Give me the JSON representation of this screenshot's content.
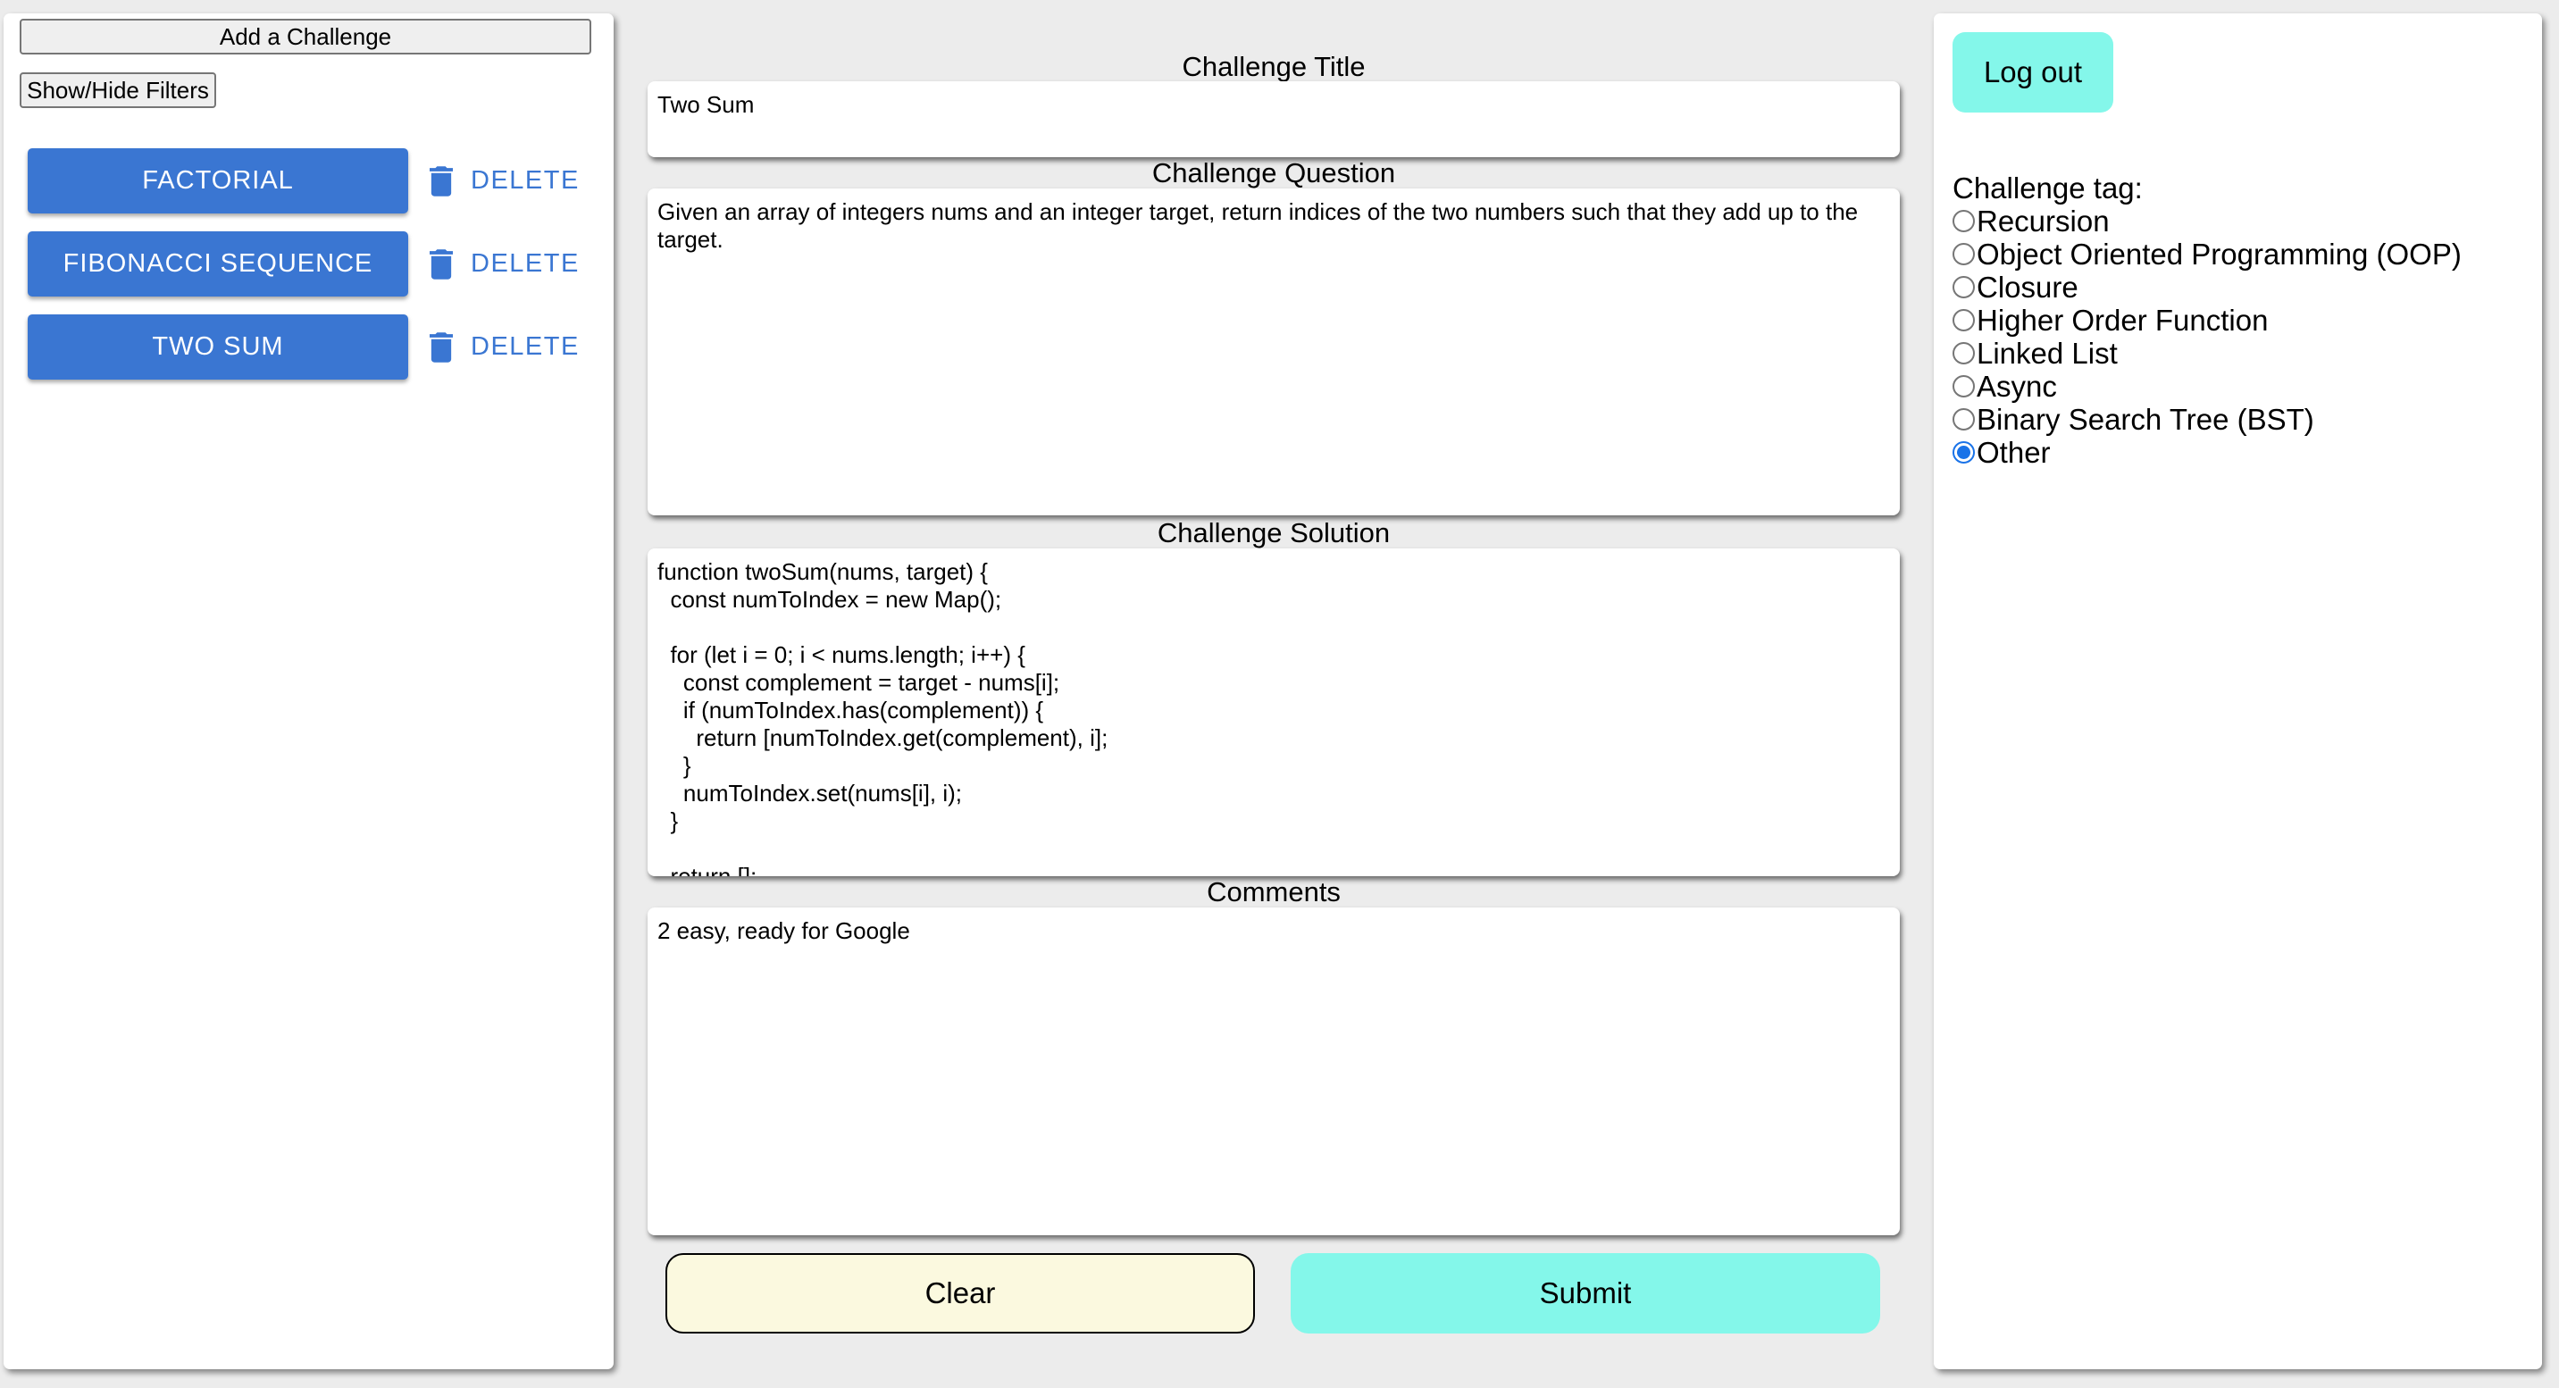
{
  "left_panel": {
    "add_button": "Add a Challenge",
    "filter_button": "Show/Hide Filters",
    "challenges": [
      {
        "label": "FACTORIAL",
        "delete_label": "DELETE"
      },
      {
        "label": "FIBONACCI SEQUENCE",
        "delete_label": "DELETE"
      },
      {
        "label": "TWO SUM",
        "delete_label": "DELETE"
      }
    ]
  },
  "form": {
    "title_label": "Challenge Title",
    "title_value": "Two Sum",
    "question_label": "Challenge Question",
    "question_value": "Given an array of integers nums and an integer target, return indices of the two numbers such that they add up to the target.",
    "solution_label": "Challenge Solution",
    "solution_value": "function twoSum(nums, target) {\n  const numToIndex = new Map();\n\n  for (let i = 0; i < nums.length; i++) {\n    const complement = target - nums[i];\n    if (numToIndex.has(complement)) {\n      return [numToIndex.get(complement), i];\n    }\n    numToIndex.set(nums[i], i);\n  }\n\n  return [];\n}",
    "comments_label": "Comments",
    "comments_value": "2 easy, ready for Google",
    "clear_button": "Clear",
    "submit_button": "Submit"
  },
  "right_panel": {
    "logout_button": "Log out",
    "tag_heading": "Challenge tag:",
    "tags": [
      {
        "label": "Recursion",
        "checked": false
      },
      {
        "label": "Object Oriented Programming (OOP)",
        "checked": false
      },
      {
        "label": "Closure",
        "checked": false
      },
      {
        "label": "Higher Order Function",
        "checked": false
      },
      {
        "label": "Linked List",
        "checked": false
      },
      {
        "label": "Async",
        "checked": false
      },
      {
        "label": "Binary Search Tree (BST)",
        "checked": false
      },
      {
        "label": "Other",
        "checked": true
      }
    ]
  },
  "colors": {
    "background": "#ececec",
    "primary_blue": "#3a76d2",
    "accent_cyan": "#84f7ea",
    "clear_button": "#fbf9df",
    "radio_checked": "#1a73e8"
  },
  "icons": {
    "delete": "trash-icon"
  }
}
